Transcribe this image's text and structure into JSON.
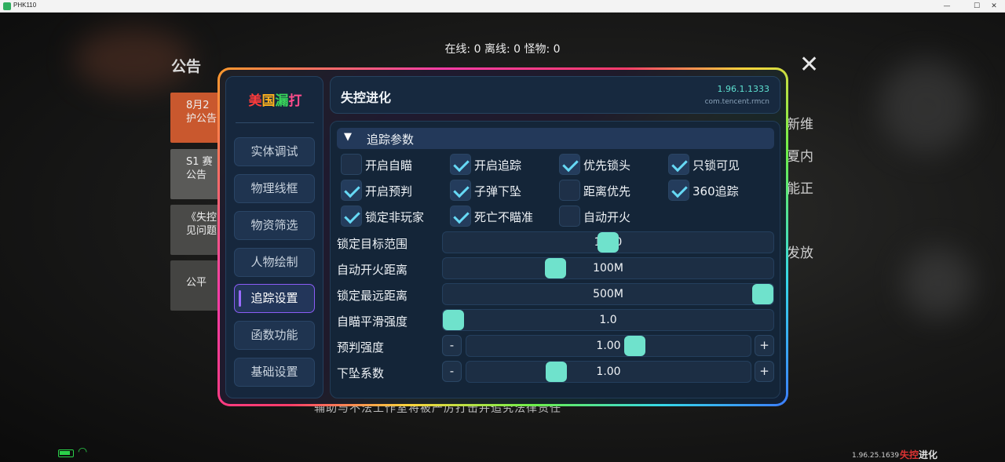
{
  "window": {
    "title": "PHK110",
    "minimize_glyph": "—",
    "maximize_glyph": "☐",
    "close_glyph": "✕"
  },
  "game": {
    "notice_title": "公告",
    "online_status": "在线: 0 离线: 0 怪物: 0",
    "close_glyph": "✕",
    "announcement_tabs": [
      {
        "line1": "8月2",
        "line2": "护公告"
      },
      {
        "line1": "S1 赛",
        "line2": "公告"
      },
      {
        "line1": "《失控",
        "line2": "见问题"
      },
      {
        "line1": "公平",
        "line2": ""
      }
    ],
    "side_texts": [
      "新维",
      "夏内",
      "能正",
      "发放"
    ],
    "bottom_text": "辅助与不法工作室将被严厉打击并追究法律责任",
    "bottom_version": "1.96.25.1639",
    "bottom_logo_prefix": "失控",
    "bottom_logo_suffix": "进化",
    "status_colors": {
      "battery": "#2bd14a"
    }
  },
  "menu": {
    "brand": [
      "美",
      "国",
      "漏",
      "打"
    ],
    "items": [
      {
        "label": "实体调试",
        "active": false
      },
      {
        "label": "物理线框",
        "active": false
      },
      {
        "label": "物资筛选",
        "active": false
      },
      {
        "label": "人物绘制",
        "active": false
      },
      {
        "label": "追踪设置",
        "active": true
      },
      {
        "label": "函数功能",
        "active": false
      },
      {
        "label": "基础设置",
        "active": false
      }
    ]
  },
  "header": {
    "title": "失控进化",
    "version": "1.96.1.1333",
    "package": "com.tencent.rmcn"
  },
  "section": {
    "expand_glyph": "▼",
    "title": "追踪参数"
  },
  "checkboxes": [
    {
      "label": "开启自瞄",
      "checked": false
    },
    {
      "label": "开启追踪",
      "checked": true
    },
    {
      "label": "优先锁头",
      "checked": true
    },
    {
      "label": "只锁可见",
      "checked": true
    },
    {
      "label": "开启预判",
      "checked": true
    },
    {
      "label": "子弹下坠",
      "checked": true
    },
    {
      "label": "距离优先",
      "checked": false
    },
    {
      "label": "360追踪",
      "checked": true
    },
    {
      "label": "锁定非玩家",
      "checked": true
    },
    {
      "label": "死亡不瞄准",
      "checked": true
    },
    {
      "label": "自动开火",
      "checked": false
    }
  ],
  "sliders": [
    {
      "label": "锁定目标范围",
      "value_text": "1000",
      "fraction": 0.5,
      "stepper": false
    },
    {
      "label": "自动开火距离",
      "value_text": "100M",
      "fraction": 0.33,
      "stepper": false
    },
    {
      "label": "锁定最远距离",
      "value_text": "500M",
      "fraction": 1.0,
      "stepper": false
    },
    {
      "label": "自瞄平滑强度",
      "value_text": "1.0",
      "fraction": 0.0,
      "stepper": false
    },
    {
      "label": "预判强度",
      "value_text": "1.00",
      "fraction": 0.6,
      "stepper": true,
      "minus": "-",
      "plus": "+"
    },
    {
      "label": "下坠系数",
      "value_text": "1.00",
      "fraction": 0.3,
      "stepper": true,
      "minus": "-",
      "plus": "+"
    }
  ],
  "accent_colors": {
    "knob": "#6fe2cc",
    "check": "#66d9f5",
    "active_menu": "#8b5cf6"
  }
}
